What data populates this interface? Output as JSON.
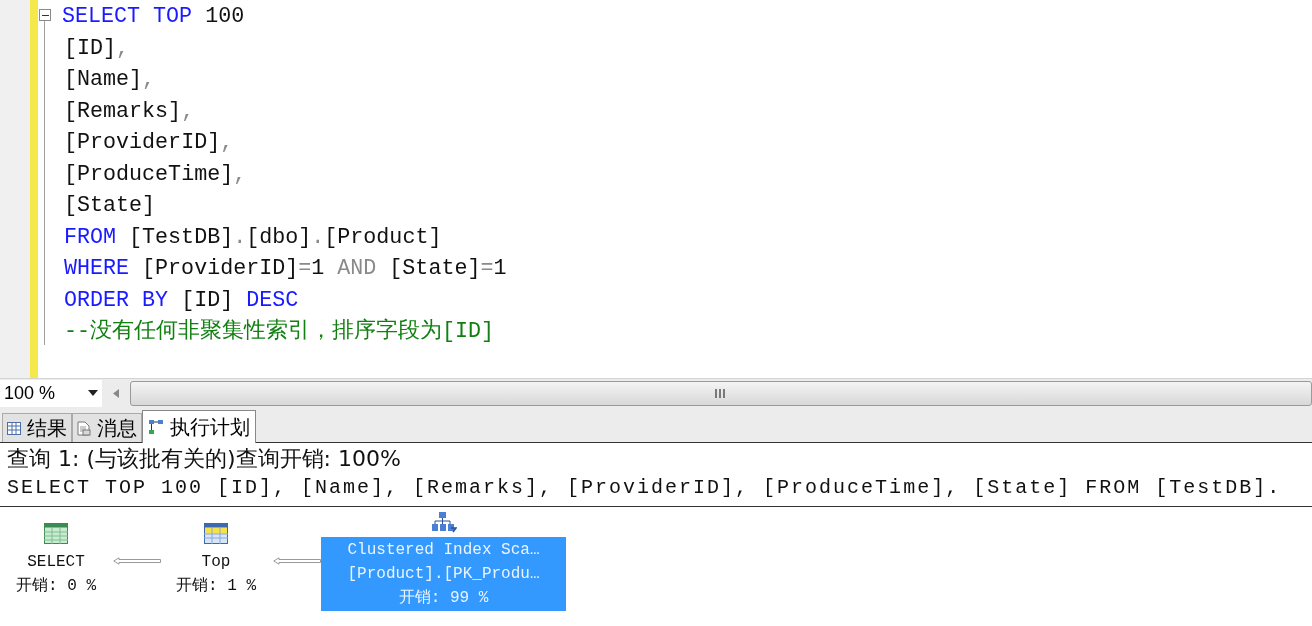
{
  "editor": {
    "expanded": true,
    "lines": [
      {
        "tokens": [
          {
            "kind": "keyword",
            "text": "SELECT"
          },
          {
            "kind": "keyword",
            "text": "TOP"
          },
          {
            "kind": "plain",
            "text": "100"
          }
        ]
      },
      {
        "tokens": [
          {
            "kind": "plain",
            "text": "[ID]"
          },
          {
            "kind": "punct",
            "text": ",",
            "tight": true
          }
        ]
      },
      {
        "tokens": [
          {
            "kind": "plain",
            "text": "[Name]"
          },
          {
            "kind": "punct",
            "text": ",",
            "tight": true
          }
        ]
      },
      {
        "tokens": [
          {
            "kind": "plain",
            "text": "[Remarks]"
          },
          {
            "kind": "punct",
            "text": ",",
            "tight": true
          }
        ]
      },
      {
        "tokens": [
          {
            "kind": "plain",
            "text": "[ProviderID]"
          },
          {
            "kind": "punct",
            "text": ",",
            "tight": true
          }
        ]
      },
      {
        "tokens": [
          {
            "kind": "plain",
            "text": "[ProduceTime]"
          },
          {
            "kind": "punct",
            "text": ",",
            "tight": true
          }
        ]
      },
      {
        "tokens": [
          {
            "kind": "plain",
            "text": "[State]"
          }
        ]
      },
      {
        "tokens": [
          {
            "kind": "keyword",
            "text": "FROM"
          },
          {
            "kind": "plain",
            "text": "[TestDB]"
          },
          {
            "kind": "punct",
            "text": ".",
            "tight": true
          },
          {
            "kind": "plain",
            "text": "[dbo]",
            "tight": true
          },
          {
            "kind": "punct",
            "text": ".",
            "tight": true
          },
          {
            "kind": "plain",
            "text": "[Product]",
            "tight": true
          }
        ]
      },
      {
        "tokens": [
          {
            "kind": "keyword",
            "text": "WHERE"
          },
          {
            "kind": "plain",
            "text": "[ProviderID]"
          },
          {
            "kind": "punct",
            "text": "=",
            "tight": true
          },
          {
            "kind": "plain",
            "text": "1",
            "tight": true
          },
          {
            "kind": "punct",
            "text": "AND"
          },
          {
            "kind": "plain",
            "text": "[State]"
          },
          {
            "kind": "punct",
            "text": "=",
            "tight": true
          },
          {
            "kind": "plain",
            "text": "1",
            "tight": true
          }
        ]
      },
      {
        "tokens": [
          {
            "kind": "keyword",
            "text": "ORDER BY"
          },
          {
            "kind": "plain",
            "text": "[ID]"
          },
          {
            "kind": "keyword",
            "text": "DESC"
          }
        ]
      },
      {
        "tokens": [
          {
            "kind": "comment",
            "text": "--没有任何非聚集性索引，排序字段为[ID]"
          }
        ]
      }
    ]
  },
  "zoom": {
    "value": "100 %"
  },
  "result_tabs": [
    {
      "label": "结果",
      "kind": "grid",
      "selected": false
    },
    {
      "label": "消息",
      "kind": "message",
      "selected": false
    },
    {
      "label": "执行计划",
      "kind": "plan",
      "selected": true
    }
  ],
  "plan": {
    "header": "查询 1: (与该批有关的)查询开销: 100%",
    "statement": "SELECT TOP 100 [ID], [Name], [Remarks], [ProviderID], [ProduceTime], [State] FROM [TestDB].",
    "nodes": [
      {
        "kind": "select",
        "lines": [
          "SELECT"
        ],
        "cost": "开销: 0 %",
        "selected": false
      },
      {
        "kind": "top",
        "lines": [
          "Top"
        ],
        "cost": "开销: 1 %",
        "selected": false
      },
      {
        "kind": "scan",
        "lines": [
          "Clustered Index Sca…",
          "[Product].[PK_Produ…"
        ],
        "cost": "开销: 99 %",
        "selected": true
      }
    ]
  }
}
